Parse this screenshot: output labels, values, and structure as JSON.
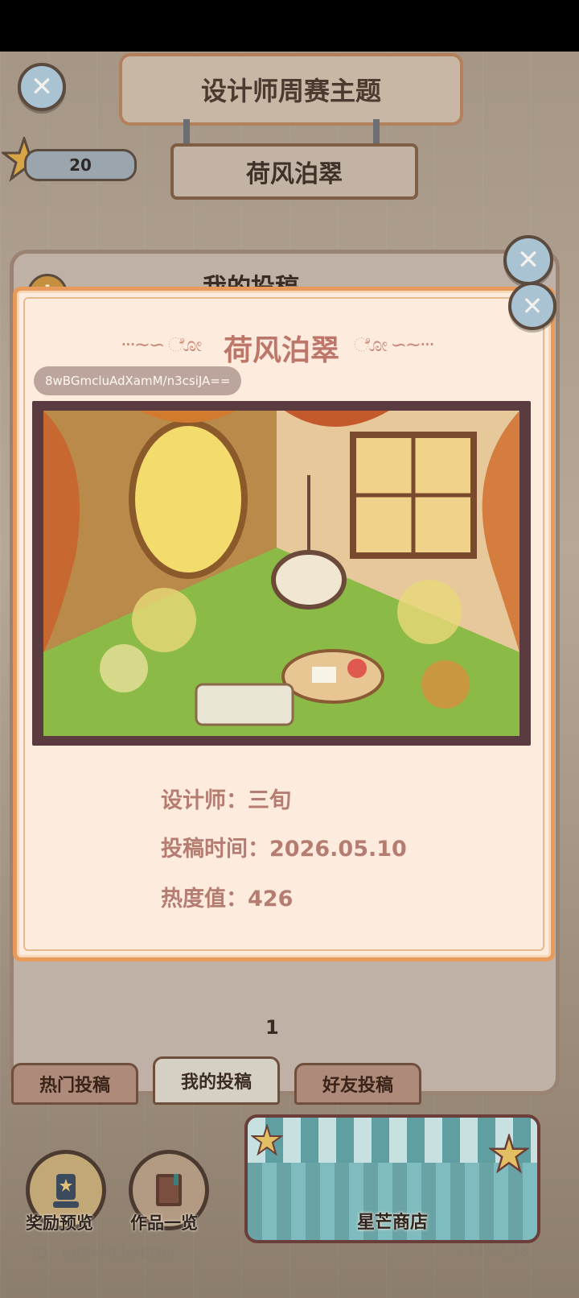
{
  "header": {
    "title": "设计师周赛主题",
    "theme_name": "荷风泊翠",
    "star_count": "20"
  },
  "back_panel": {
    "title": "我的投稿",
    "page_number": "1"
  },
  "tabs": [
    {
      "label": "热门投稿"
    },
    {
      "label": "我的投稿"
    },
    {
      "label": "好友投稿"
    }
  ],
  "bottom": {
    "reward_label": "奖励预览",
    "works_label": "作品一览",
    "shop_label": "星芒商店",
    "user_id": "ID：gdZnMEhABOef",
    "version": "V.3.10.0_18"
  },
  "modal": {
    "title": "荷风泊翠",
    "share_code": "8wBGmcluAdXamM/n3csiJA==",
    "designer_label": "设计师：",
    "designer": "三旬",
    "date_label": "投稿时间：",
    "date": "2026.05.10",
    "heat_label": "热度值：",
    "heat": "426"
  },
  "colors": {
    "modal_border": "#e89a5a",
    "modal_bg": "#fdebdd",
    "title_text": "#bd776a"
  }
}
